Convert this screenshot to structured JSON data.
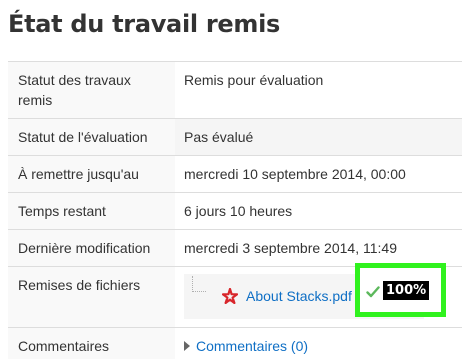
{
  "page": {
    "title": "État du travail remis"
  },
  "summary": {
    "submission_status_label": "Statut des travaux remis",
    "submission_status_value": "Remis pour évaluation",
    "grading_status_label": "Statut de l'évaluation",
    "grading_status_value": "Pas évalué",
    "due_date_label": "À remettre jusqu'au",
    "due_date_value": "mercredi 10 septembre 2014, 00:00",
    "time_remaining_label": "Temps restant",
    "time_remaining_value": "6 jours 10 heures",
    "last_modified_label": "Dernière modification",
    "last_modified_value": "mercredi 3 septembre 2014, 11:49",
    "file_submissions_label": "Remises de fichiers",
    "file_name": "About Stacks.pdf",
    "file_icon": "pdf-icon",
    "status_icon": "checkmark-icon",
    "progress_badge": "100%",
    "comments_label": "Commentaires",
    "comments_link": "Commentaires (0)"
  },
  "colors": {
    "link": "#0f6fc5",
    "highlight": "#30f21e",
    "pdf": "#d8262b",
    "check": "#5cb85c"
  }
}
